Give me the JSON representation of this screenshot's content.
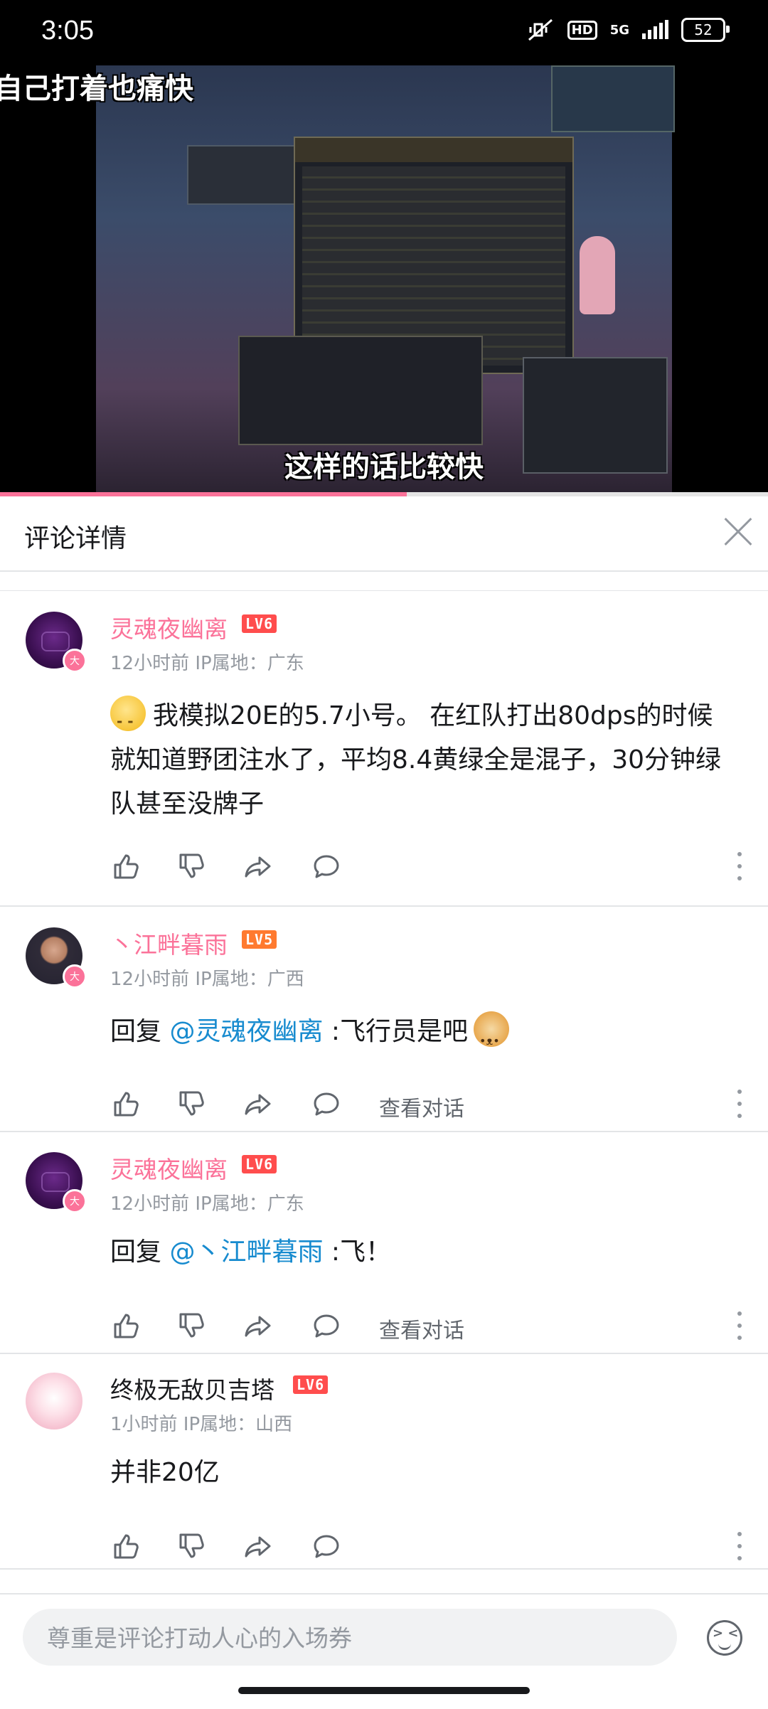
{
  "status_bar": {
    "time": "3:05",
    "network": "5G",
    "battery": "52",
    "hd_label": "HD"
  },
  "video": {
    "title_overlay": "自己打着也痛快",
    "subtitle": "这样的话比较快",
    "progress": 0.53,
    "progress_color": "#fb7299"
  },
  "panel": {
    "title": "评论详情"
  },
  "comments": [
    {
      "username": "灵魂夜幽离",
      "level": "LV6",
      "meta": "12小时前 IP属地：广东",
      "emoji": "thinking-face-emoji",
      "text": "我模拟20E的5.7小号。 在红队打出80dps的时候就知道野团注水了，平均8.4黄绿全是混子，30分钟绿队甚至没牌子"
    },
    {
      "username": "丶江畔暮雨",
      "level": "LV5",
      "meta": "12小时前 IP属地：广西",
      "reply_prefix": "回复 ",
      "mention": "@灵魂夜幽离",
      "text": " :飞行员是吧",
      "emoji": "doge-emoji",
      "view_conversation": "查看对话"
    },
    {
      "username": "灵魂夜幽离",
      "level": "LV6",
      "meta": "12小时前 IP属地：广东",
      "reply_prefix": "回复 ",
      "mention": "@丶江畔暮雨",
      "text": " :飞！",
      "view_conversation": "查看对话"
    },
    {
      "username": "终极无敌贝吉塔",
      "level": "LV6",
      "meta": "1小时前 IP属地：山西",
      "text": "并非20亿"
    }
  ],
  "avatar_badge": "大",
  "input": {
    "placeholder": "尊重是评论打动人心的入场券"
  },
  "colors": {
    "accent": "#fb7299",
    "mention": "#178bcf",
    "level_red": "#ff4d4d",
    "level_orange": "#ff7a2f"
  }
}
